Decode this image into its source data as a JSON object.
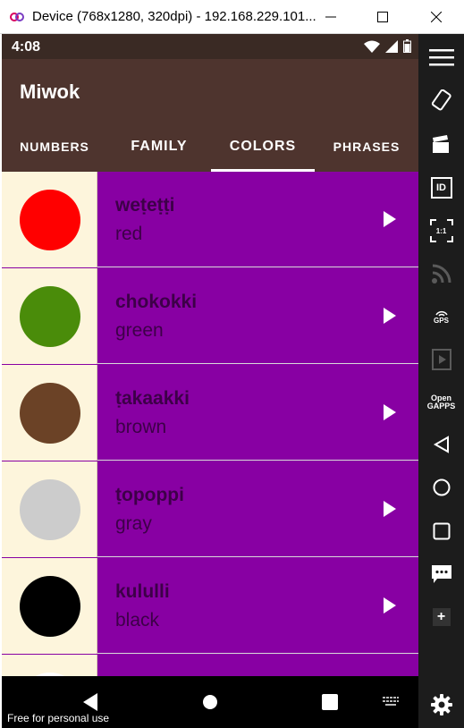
{
  "window": {
    "title": "Device (768x1280, 320dpi) - 192.168.229.101...",
    "app_icon": "genymotion-icon",
    "controls": [
      "minimize-icon",
      "maximize-icon",
      "close-icon"
    ]
  },
  "status_bar": {
    "time": "4:08",
    "icons": [
      "wifi-icon",
      "cell-signal-icon",
      "battery-icon"
    ]
  },
  "app_bar": {
    "title": "Miwok"
  },
  "tabs": [
    {
      "label": "NUMBERS",
      "selected": false
    },
    {
      "label": "FAMILY",
      "selected": false
    },
    {
      "label": "COLORS",
      "selected": true
    },
    {
      "label": "PHRASES",
      "selected": false
    }
  ],
  "colors": {
    "app_bar": "#4e342e",
    "status_bar": "#3a2a24",
    "list_background": "#8800a3",
    "thumbnail_background": "#fdf5dc",
    "text_dark": "#3d0048"
  },
  "words": [
    {
      "miwok": "weṭeṭṭi",
      "english": "red",
      "swatch": "#ff0000"
    },
    {
      "miwok": "chokokki",
      "english": "green",
      "swatch": "#4a8c0a"
    },
    {
      "miwok": "ṭakaakki",
      "english": "brown",
      "swatch": "#6b4226"
    },
    {
      "miwok": "ṭopoppi",
      "english": "gray",
      "swatch": "#cccccc"
    },
    {
      "miwok": "kululli",
      "english": "black",
      "swatch": "#000000"
    },
    {
      "miwok": "",
      "english": "",
      "swatch": "#ffffff"
    }
  ],
  "nav_bar": {
    "buttons": [
      "back-icon",
      "home-icon",
      "recents-icon",
      "keyboard-icon"
    ],
    "watermark": "Free for personal use"
  },
  "sidebar": {
    "buttons": [
      {
        "name": "menu-icon"
      },
      {
        "name": "rotate-icon"
      },
      {
        "name": "capture-icon"
      },
      {
        "name": "device-id-icon",
        "text": "ID"
      },
      {
        "name": "pixel-perfect-icon",
        "text": "1:1"
      },
      {
        "name": "network-icon"
      },
      {
        "name": "gps-icon",
        "text": "GPS"
      },
      {
        "name": "media-icon"
      },
      {
        "name": "open-gapps-icon",
        "text": "Open GAPPS"
      },
      {
        "name": "back-icon"
      },
      {
        "name": "home-icon"
      },
      {
        "name": "recents-icon"
      },
      {
        "name": "sms-icon"
      },
      {
        "name": "add-icon",
        "text": "+"
      },
      {
        "name": "settings-icon"
      }
    ]
  }
}
